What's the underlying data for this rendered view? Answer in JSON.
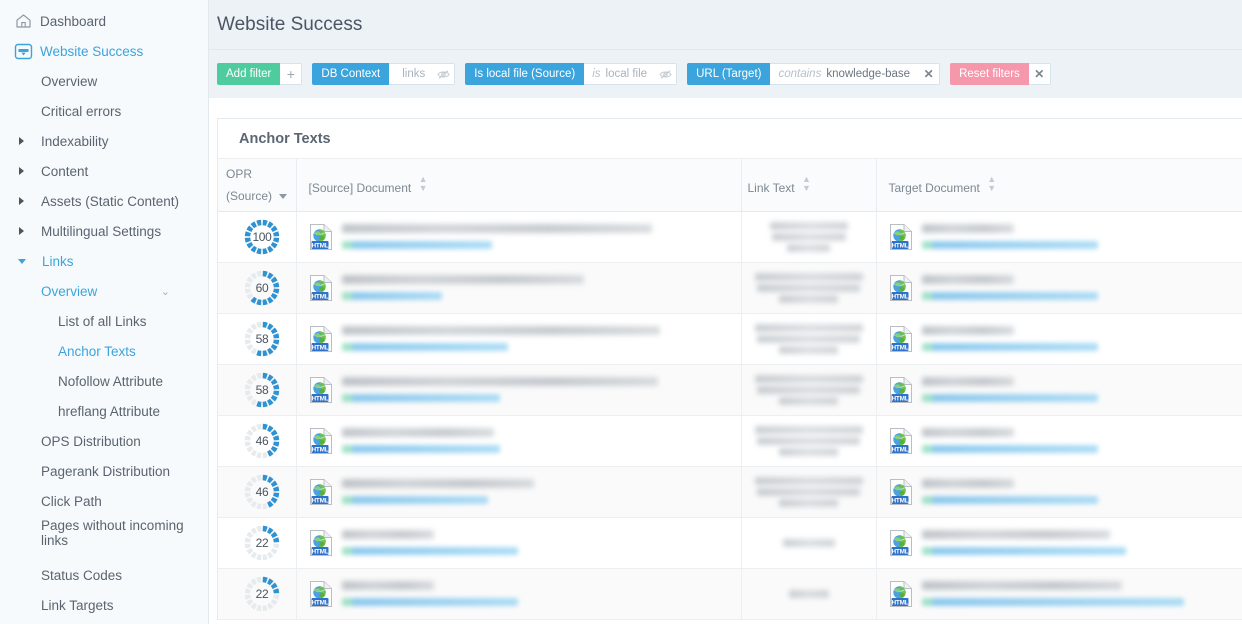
{
  "sidebar": {
    "items": [
      {
        "label": "Dashboard",
        "icon": "home-icon",
        "level": 0,
        "active": false,
        "expandable": false
      },
      {
        "label": "Website Success",
        "icon": "website-success-icon",
        "level": 0,
        "active": true,
        "expandable": false
      },
      {
        "label": "Overview",
        "level": 1,
        "active": false,
        "expandable": false
      },
      {
        "label": "Critical errors",
        "level": 1,
        "active": false,
        "expandable": false
      },
      {
        "label": "Indexability",
        "level": 1,
        "active": false,
        "expandable": true,
        "expanded": false
      },
      {
        "label": "Content",
        "level": 1,
        "active": false,
        "expandable": true,
        "expanded": false
      },
      {
        "label": "Assets (Static Content)",
        "level": 1,
        "active": false,
        "expandable": true,
        "expanded": false
      },
      {
        "label": "Multilingual Settings",
        "level": 1,
        "active": false,
        "expandable": true,
        "expanded": false
      },
      {
        "label": "Links",
        "level": 1,
        "active": true,
        "expandable": true,
        "expanded": true
      },
      {
        "label": "Overview",
        "level": 2,
        "active": true,
        "expandable": false,
        "chevron": "chevron-down-icon"
      },
      {
        "label": "List of all Links",
        "level": 3,
        "active": false,
        "expandable": false
      },
      {
        "label": "Anchor Texts",
        "level": 3,
        "active": true,
        "expandable": false
      },
      {
        "label": "Nofollow Attribute",
        "level": 3,
        "active": false,
        "expandable": false
      },
      {
        "label": "hreflang Attribute",
        "level": 3,
        "active": false,
        "expandable": false
      },
      {
        "label": "OPS Distribution",
        "level": 2,
        "active": false,
        "expandable": false
      },
      {
        "label": "Pagerank Distribution",
        "level": 2,
        "active": false,
        "expandable": false
      },
      {
        "label": "Click Path",
        "level": 2,
        "active": false,
        "expandable": false
      },
      {
        "label": "Pages without incoming links",
        "level": 2,
        "active": false,
        "expandable": false
      },
      {
        "label": "Status Codes",
        "level": 2,
        "active": false,
        "expandable": false
      },
      {
        "label": "Link Targets",
        "level": 2,
        "active": false,
        "expandable": false
      }
    ]
  },
  "header": {
    "title": "Website Success"
  },
  "filters": {
    "add_filter_label": "Add filter",
    "add_filter_plus": "+",
    "chips": [
      {
        "label": "DB Context",
        "color": "blue",
        "operator": "",
        "value": "links",
        "placeholder": true,
        "trailing": "eye-off-icon"
      },
      {
        "label": "Is local file (Source)",
        "color": "blue",
        "operator": "is",
        "value": "local file",
        "placeholder": true,
        "trailing": "eye-off-icon"
      },
      {
        "label": "URL (Target)",
        "color": "blue",
        "operator": "contains",
        "value": "knowledge-base",
        "placeholder": false,
        "trailing": "close-icon"
      }
    ],
    "reset": {
      "label": "Reset filters",
      "color": "pink",
      "trailing": "close-icon"
    }
  },
  "panel": {
    "title": "Anchor Texts",
    "columns": [
      {
        "key": "opr",
        "line1": "OPR",
        "line2": "(Source)",
        "sortable": true,
        "control": "dropdown-caret-icon"
      },
      {
        "key": "src",
        "label": "[Source] Document",
        "sortable": true,
        "control": "sort-icon"
      },
      {
        "key": "link",
        "label": "Link Text",
        "sortable": true,
        "control": "sort-icon"
      },
      {
        "key": "tgt",
        "label": "Target Document",
        "sortable": true,
        "control": "sort-icon"
      }
    ],
    "rows": [
      {
        "opr": 100,
        "src_icon": "html-file-icon",
        "src_title_w": 310,
        "src_url_w": 150,
        "link_w": 78,
        "tgt_icon": "html-file-icon",
        "tgt_title_w": 92,
        "tgt_url_w": 176
      },
      {
        "opr": 60,
        "src_icon": "html-file-icon",
        "src_title_w": 242,
        "src_url_w": 100,
        "link_w": 108,
        "tgt_icon": "html-file-icon",
        "tgt_title_w": 92,
        "tgt_url_w": 176
      },
      {
        "opr": 58,
        "src_icon": "html-file-icon",
        "src_title_w": 318,
        "src_url_w": 166,
        "link_w": 108,
        "tgt_icon": "html-file-icon",
        "tgt_title_w": 92,
        "tgt_url_w": 176
      },
      {
        "opr": 58,
        "src_icon": "html-file-icon",
        "src_title_w": 316,
        "src_url_w": 158,
        "link_w": 108,
        "tgt_icon": "html-file-icon",
        "tgt_title_w": 92,
        "tgt_url_w": 176
      },
      {
        "opr": 46,
        "src_icon": "html-file-icon",
        "src_title_w": 152,
        "src_url_w": 158,
        "link_w": 108,
        "tgt_icon": "html-file-icon",
        "tgt_title_w": 92,
        "tgt_url_w": 176
      },
      {
        "opr": 46,
        "src_icon": "html-file-icon",
        "src_title_w": 192,
        "src_url_w": 146,
        "link_w": 108,
        "tgt_icon": "html-file-icon",
        "tgt_title_w": 92,
        "tgt_url_w": 176
      },
      {
        "opr": 22,
        "src_icon": "html-file-icon",
        "src_title_w": 92,
        "src_url_w": 176,
        "link_w": 52,
        "tgt_icon": "html-file-icon",
        "tgt_title_w": 188,
        "tgt_url_w": 204
      },
      {
        "opr": 22,
        "src_icon": "html-file-icon",
        "src_title_w": 92,
        "src_url_w": 176,
        "link_w": 40,
        "tgt_icon": "html-file-icon",
        "tgt_title_w": 200,
        "tgt_url_w": 262
      }
    ]
  },
  "colors": {
    "accent_blue": "#3ba4dd",
    "green": "#4ecca0",
    "pink": "#f598ab",
    "sidebar_bg": "#f7fafc",
    "topbar_bg": "#edf2f7",
    "gauge_fill": "#3092d0",
    "gauge_track": "#e7ebee"
  }
}
